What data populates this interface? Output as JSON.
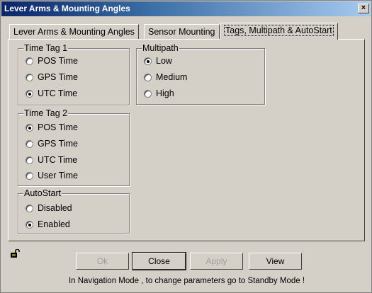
{
  "window": {
    "title": "Lever Arms & Mounting Angles",
    "close_glyph": "×"
  },
  "tabs": [
    {
      "label": "Lever Arms & Mounting Angles",
      "active": false
    },
    {
      "label": "Sensor Mounting",
      "active": false
    },
    {
      "label": "Tags, Multipath & AutoStart",
      "active": true
    }
  ],
  "time_tag_1": {
    "label": "Time Tag 1",
    "options": [
      {
        "label": "POS Time",
        "checked": false
      },
      {
        "label": "GPS Time",
        "checked": false
      },
      {
        "label": "UTC Time",
        "checked": true
      }
    ]
  },
  "time_tag_2": {
    "label": "Time Tag 2",
    "options": [
      {
        "label": "POS Time",
        "checked": true
      },
      {
        "label": "GPS Time",
        "checked": false
      },
      {
        "label": "UTC Time",
        "checked": false
      },
      {
        "label": "User Time",
        "checked": false
      }
    ]
  },
  "autostart": {
    "label": "AutoStart",
    "options": [
      {
        "label": "Disabled",
        "checked": false
      },
      {
        "label": "Enabled",
        "checked": true
      }
    ]
  },
  "multipath": {
    "label": "Multipath",
    "options": [
      {
        "label": "Low",
        "checked": true
      },
      {
        "label": "Medium",
        "checked": false
      },
      {
        "label": "High",
        "checked": false
      }
    ]
  },
  "buttons": {
    "ok": "Ok",
    "close": "Close",
    "apply": "Apply",
    "view": "View"
  },
  "status_text": "In Navigation Mode , to change parameters go to Standby Mode !",
  "icons": {
    "lock": "lock-icon"
  }
}
